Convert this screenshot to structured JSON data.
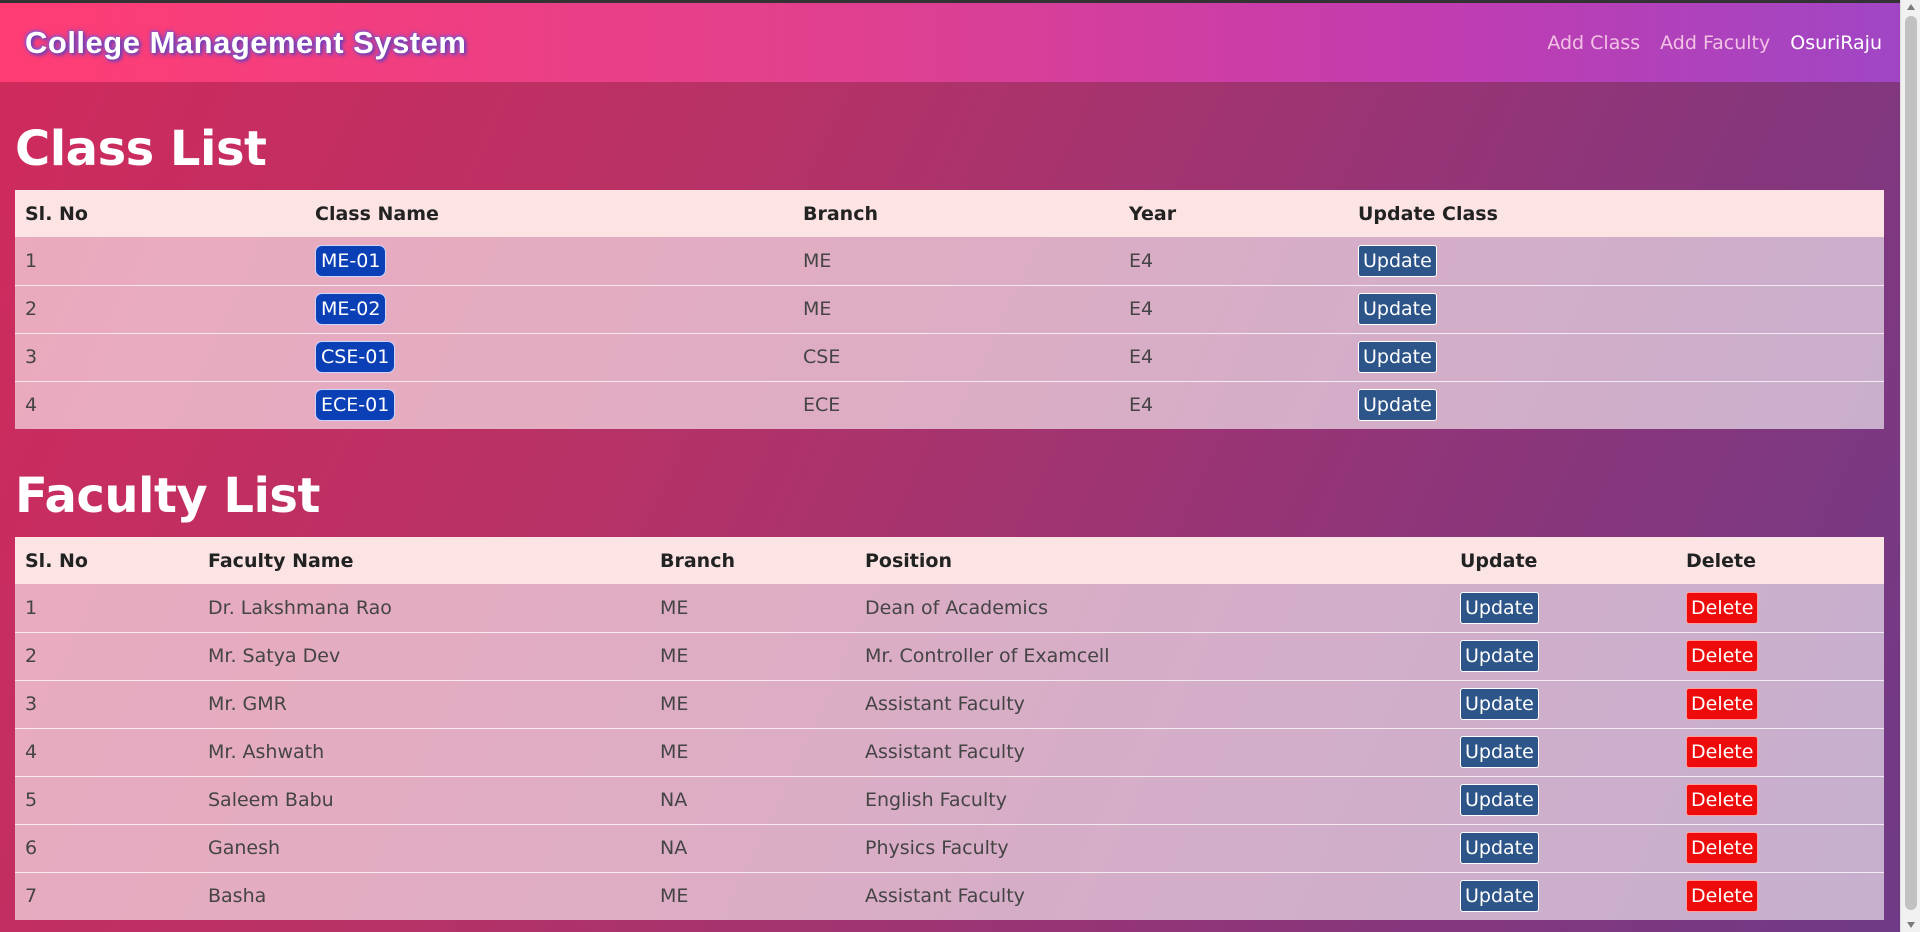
{
  "header": {
    "brand": "College Management System",
    "nav": {
      "add_class": "Add Class",
      "add_faculty": "Add Faculty",
      "user": "OsuriRaju"
    }
  },
  "class_list": {
    "title": "Class List",
    "columns": [
      "Sl. No",
      "Class Name",
      "Branch",
      "Year",
      "Update Class"
    ],
    "rows": [
      {
        "sl": "1",
        "name": "ME-01",
        "branch": "ME",
        "year": "E4",
        "action": "Update"
      },
      {
        "sl": "2",
        "name": "ME-02",
        "branch": "ME",
        "year": "E4",
        "action": "Update"
      },
      {
        "sl": "3",
        "name": "CSE-01",
        "branch": "CSE",
        "year": "E4",
        "action": "Update"
      },
      {
        "sl": "4",
        "name": "ECE-01",
        "branch": "ECE",
        "year": "E4",
        "action": "Update"
      }
    ]
  },
  "faculty_list": {
    "title": "Faculty List",
    "columns": [
      "Sl. No",
      "Faculty Name",
      "Branch",
      "Position",
      "Update",
      "Delete"
    ],
    "rows": [
      {
        "sl": "1",
        "name": "Dr. Lakshmana Rao",
        "branch": "ME",
        "position": "Dean of Academics",
        "update": "Update",
        "delete": "Delete"
      },
      {
        "sl": "2",
        "name": "Mr. Satya Dev",
        "branch": "ME",
        "position": "Mr. Controller of Examcell",
        "update": "Update",
        "delete": "Delete"
      },
      {
        "sl": "3",
        "name": "Mr. GMR",
        "branch": "ME",
        "position": "Assistant Faculty",
        "update": "Update",
        "delete": "Delete"
      },
      {
        "sl": "4",
        "name": "Mr. Ashwath",
        "branch": "ME",
        "position": "Assistant Faculty",
        "update": "Update",
        "delete": "Delete"
      },
      {
        "sl": "5",
        "name": "Saleem Babu",
        "branch": "NA",
        "position": "English Faculty",
        "update": "Update",
        "delete": "Delete"
      },
      {
        "sl": "6",
        "name": "Ganesh",
        "branch": "NA",
        "position": "Physics Faculty",
        "update": "Update",
        "delete": "Delete"
      },
      {
        "sl": "7",
        "name": "Basha",
        "branch": "ME",
        "position": "Assistant Faculty",
        "update": "Update",
        "delete": "Delete"
      }
    ]
  },
  "colors": {
    "class_button": "#0b3fb6",
    "update_button": "#2e5589",
    "delete_button": "#ee0b0b",
    "header_row": "#fce4e4"
  }
}
